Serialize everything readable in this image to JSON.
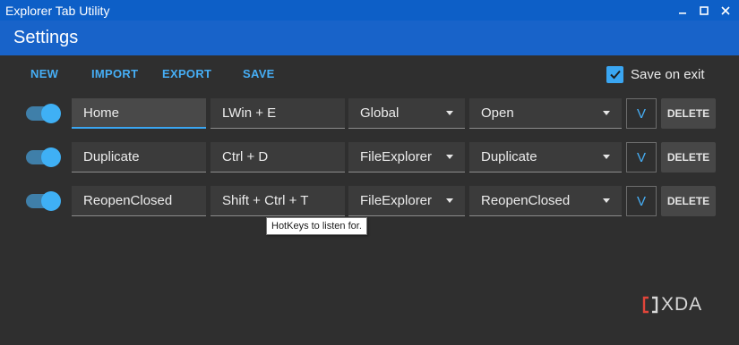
{
  "window": {
    "title": "Explorer Tab Utility",
    "controls": {
      "minimize": "–",
      "maximize": "□",
      "close": "✕"
    }
  },
  "header": {
    "title": "Settings"
  },
  "toolbar": {
    "new": "NEW",
    "import": "IMPORT",
    "export": "EXPORT",
    "save": "SAVE"
  },
  "save_on_exit": {
    "label": "Save on exit",
    "checked": true
  },
  "rows": [
    {
      "enabled": true,
      "name": "Home",
      "hotkey": "LWin + E",
      "scope": "Global",
      "action": "Open",
      "expand": "V",
      "delete": "DELETE"
    },
    {
      "enabled": true,
      "name": "Duplicate",
      "hotkey": "Ctrl + D",
      "scope": "FileExplorer",
      "action": "Duplicate",
      "expand": "V",
      "delete": "DELETE"
    },
    {
      "enabled": true,
      "name": "ReopenClosed",
      "hotkey": "Shift + Ctrl + T",
      "scope": "FileExplorer",
      "action": "ReopenClosed",
      "expand": "V",
      "delete": "DELETE"
    }
  ],
  "tooltip": "HotKeys to listen for.",
  "watermark": {
    "text": "XDA"
  },
  "colors": {
    "titlebar": "#0d5fc7",
    "appbar": "#1863c9",
    "background": "#2f2f2f",
    "accent": "#3aa6f2",
    "watermark_red": "#e0453a"
  }
}
